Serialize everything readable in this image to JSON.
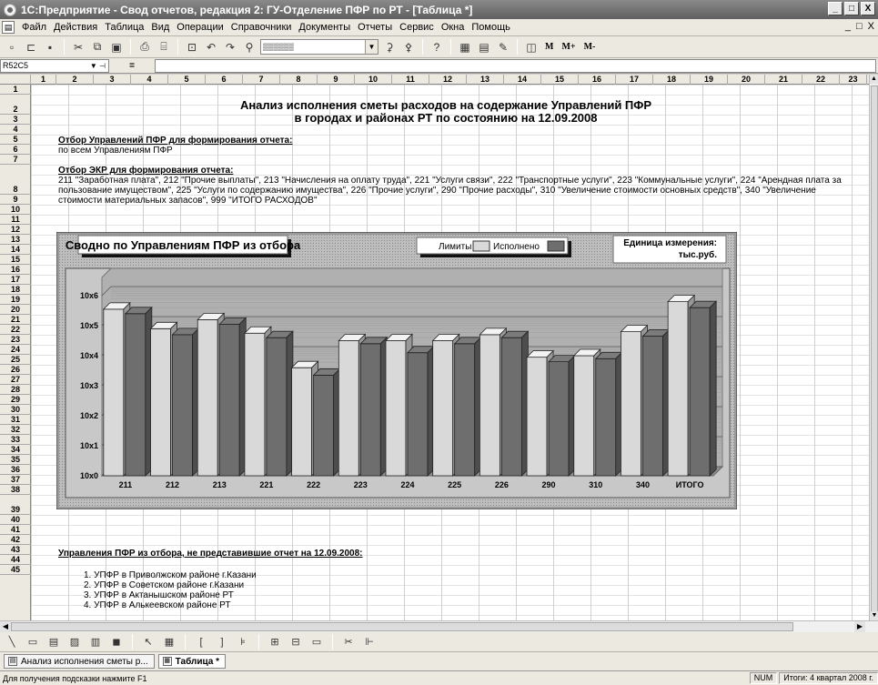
{
  "window": {
    "title": "1С:Предприятие - Свод отчетов, редакция 2:  ГУ-Отделение ПФР по РТ - [Таблица *]",
    "btn_min": "_",
    "btn_max": "□",
    "btn_close": "X"
  },
  "menu": {
    "items": [
      "Файл",
      "Действия",
      "Таблица",
      "Вид",
      "Операции",
      "Справочники",
      "Документы",
      "Отчеты",
      "Сервис",
      "Окна",
      "Помощь"
    ],
    "mdi_controls": [
      "_",
      "□",
      "X"
    ]
  },
  "toolbar": {
    "combo_value": "▒▒▒▒▒▒",
    "text_buttons": [
      "M",
      "M+",
      "M-"
    ]
  },
  "formula": {
    "cell_ref": "R52C5",
    "symbol": "="
  },
  "columns": [
    "1",
    "2",
    "3",
    "4",
    "5",
    "6",
    "7",
    "8",
    "9",
    "10",
    "11",
    "12",
    "13",
    "14",
    "15",
    "16",
    "17",
    "18",
    "19",
    "20",
    "21",
    "22",
    "23"
  ],
  "rows": [
    "1",
    "2",
    "3",
    "4",
    "5",
    "6",
    "7",
    "8",
    "9",
    "10",
    "11",
    "12",
    "13",
    "14",
    "15",
    "16",
    "17",
    "18",
    "19",
    "20",
    "21",
    "22",
    "23",
    "24",
    "25",
    "26",
    "27",
    "28",
    "29",
    "30",
    "31",
    "32",
    "33",
    "34",
    "35",
    "36",
    "37",
    "38",
    "39",
    "40",
    "41",
    "42",
    "43",
    "44",
    "45"
  ],
  "report": {
    "title_line1": "Анализ исполнения сметы расходов на содержание Управлений ПФР",
    "title_line2": "в городах и районах РТ по состоянию на 12.09.2008",
    "filter_mgmt_label": "Отбор Управлений ПФР для формирования отчета:",
    "filter_mgmt_value": "по всем Управлениям ПФР",
    "filter_ekr_label": "Отбор ЭКР для формирования отчета:",
    "filter_ekr_value": "211 \"Заработная плата\", 212 \"Прочие выплаты\", 213 \"Начисления на оплату труда\", 221 \"Услуги связи\", 222 \"Транспортные услуги\", 223 \"Коммунальные услуги\", 224 \"Арендная плата за пользование имуществом\", 225 \"Услуги по содержанию имущества\", 226 \"Прочие услуги\", 290 \"Прочие расходы\", 310 \"Увеличение стоимости основных средств\", 340 \"Увеличение стоимости материальных запасов\", 999 \"ИТОГО РАСХОДОВ\"",
    "missing_label": "Управления ПФР из отбора, не представившие отчет на 12.09.2008:",
    "missing_items": [
      "1.  УПФР в Приволжском районе г.Казани",
      "2.  УПФР в Советском районе г.Казани",
      "3.  УПФР в Актанышском районе РТ",
      "4.  УПФР в Алькеевском районе РТ"
    ]
  },
  "chart_data": {
    "type": "bar",
    "title": "Сводно по Управлениям ПФР из отбора",
    "unit_label_line1": "Единица измерения:",
    "unit_label_line2": "тыс.руб.",
    "log_scale": true,
    "categories": [
      "211",
      "212",
      "213",
      "221",
      "222",
      "223",
      "224",
      "225",
      "226",
      "290",
      "310",
      "340",
      "ИТОГО"
    ],
    "ytick_labels": [
      "10x0",
      "10x1",
      "10x2",
      "10x3",
      "10x4",
      "10x5",
      "10x6"
    ],
    "ylim_exp": [
      0,
      6
    ],
    "series": [
      {
        "name": "Лимиты",
        "color": "#d9d9d9",
        "exp": [
          5.55,
          4.9,
          5.2,
          4.75,
          3.6,
          4.5,
          4.5,
          4.5,
          4.7,
          3.95,
          4.0,
          4.8,
          5.8
        ]
      },
      {
        "name": "Исполнено",
        "color": "#6e6e6e",
        "exp": [
          5.4,
          4.7,
          5.05,
          4.6,
          3.35,
          4.4,
          4.1,
          4.4,
          4.6,
          3.8,
          3.9,
          4.65,
          5.6
        ]
      }
    ]
  },
  "drawbar_tools": [
    "line-tool",
    "rect-tool",
    "text-tool",
    "picture-tool",
    "chart-tool",
    "ole-tool",
    "select-tool",
    "grid-tool",
    "bracket-open",
    "bracket-close",
    "group-tool",
    "table-tool",
    "cols-tool",
    "frame-tool",
    "cut-tool",
    "header-tool"
  ],
  "window_tabs": [
    {
      "label": "Анализ исполнения сметы р...",
      "active": false
    },
    {
      "label": "Таблица  *",
      "active": true
    }
  ],
  "status": {
    "hint": "Для получения подсказки нажмите F1",
    "num": "NUM",
    "totals": "Итоги: 4 квартал 2008 г."
  }
}
